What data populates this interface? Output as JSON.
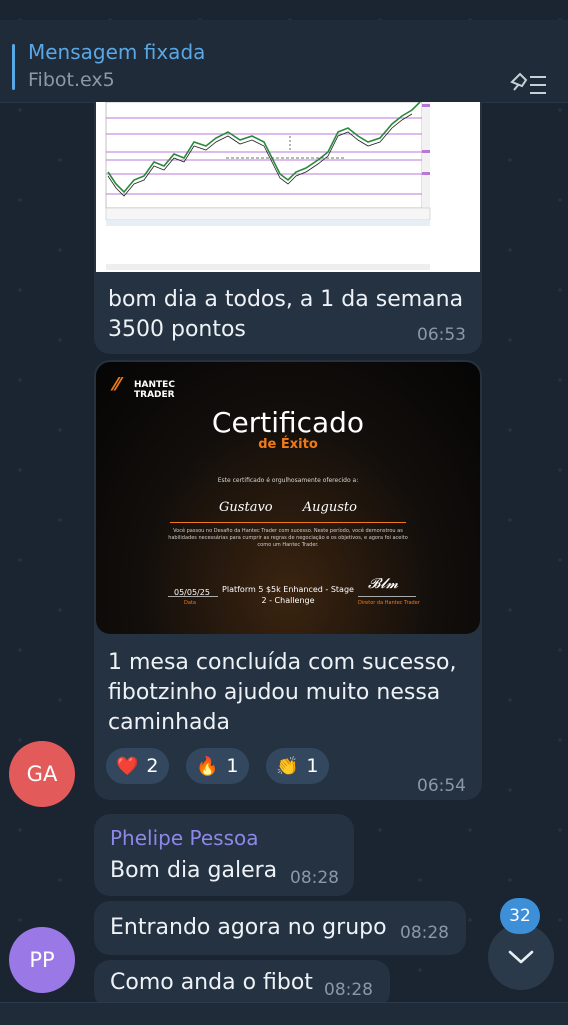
{
  "pinned": {
    "title": "Mensagem fixada",
    "subtitle": "Fibot.ex5",
    "icon": "unpin-list-icon"
  },
  "messages": [
    {
      "text": "bom dia a todos, a 1 da semana 3500 pontos",
      "time": "06:53"
    },
    {
      "certificate": {
        "brand": "HANTEC TRADER",
        "title": "Certificado",
        "subtitle": "de Éxito",
        "presented": "Este certificado é orgulhosamente oferecido a:",
        "name": "Gustavo Augusto",
        "body": "Você passou no Desafio da Hantec Trader com sucesso. Neste período, você demonstrou as habilidades necessárias para cumprir as regras de negociação e os objetivos, e agora foi aceito como um Hantec Trader.",
        "date": "05/05/25",
        "date_label": "Data",
        "platform": "Platform 5 $5k Enhanced - Stage 2 - Challenge",
        "signer_label": "Diretor da Hantec Trader"
      },
      "text": "1 mesa concluída com sucesso, fibotzinho ajudou muito nessa caminhada",
      "time": "06:54",
      "reactions": [
        {
          "emoji": "❤️",
          "count": "2"
        },
        {
          "emoji": "🔥",
          "count": "1"
        },
        {
          "emoji": "👏",
          "count": "1"
        }
      ]
    },
    {
      "sender": "Phelipe Pessoa",
      "text": "Bom dia galera",
      "time": "08:28"
    },
    {
      "text": "Entrando agora no grupo",
      "time": "08:28"
    },
    {
      "text": "Como anda o fibot",
      "time": "08:28"
    }
  ],
  "avatars": {
    "ga": "GA",
    "pp": "PP"
  },
  "unread_badge": "32",
  "colors": {
    "accent": "#5aa7e6",
    "sender": "#8f87e8",
    "bubble": "#243242",
    "background": "#1b2531"
  }
}
